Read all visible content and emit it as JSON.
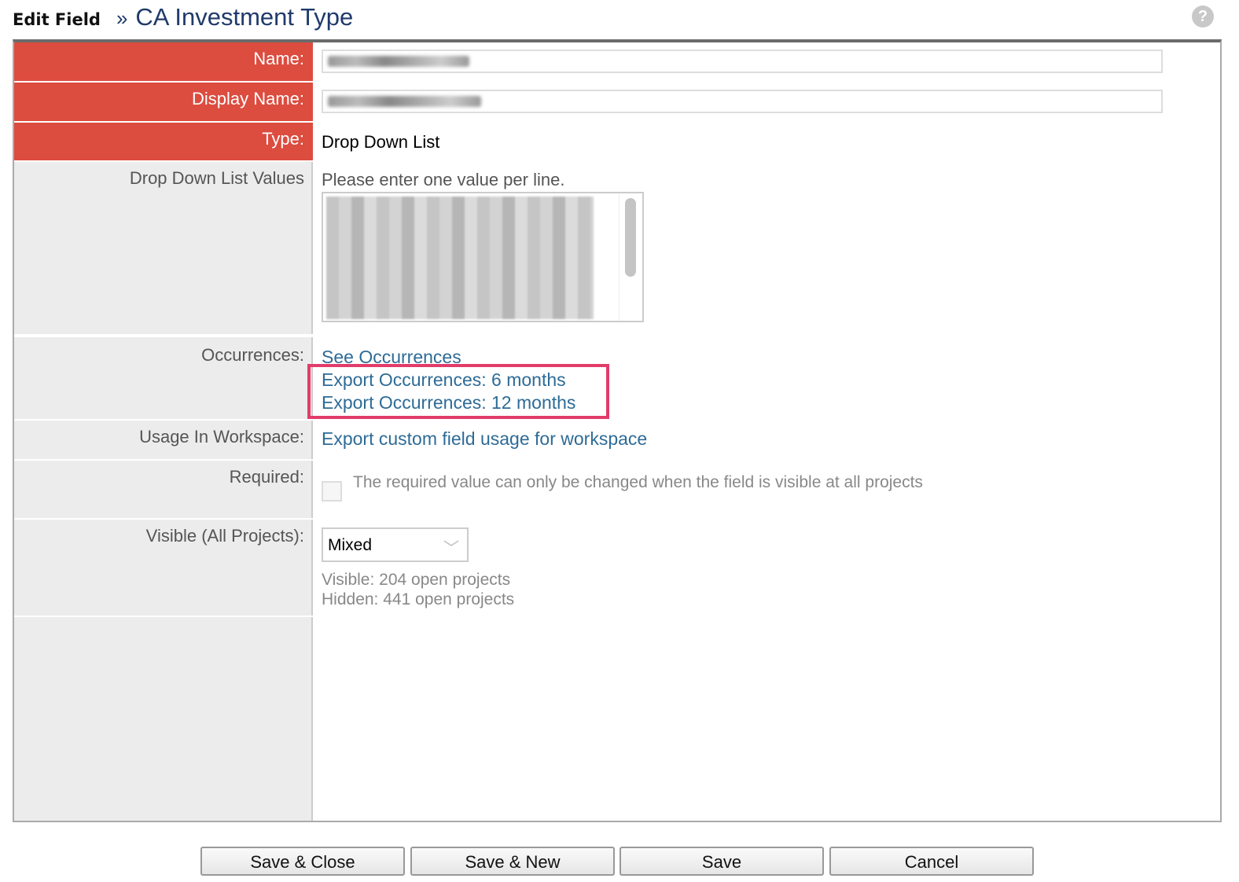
{
  "header": {
    "section": "Edit Field",
    "separator": "»",
    "title": "CA Investment Type",
    "help_icon": "?"
  },
  "fields": {
    "name": {
      "label": "Name:"
    },
    "display_name": {
      "label": "Display Name:"
    },
    "type": {
      "label": "Type:",
      "value": "Drop Down List"
    },
    "ddl_values": {
      "label": "Drop Down List Values",
      "hint": "Please enter one value per line."
    },
    "occurrences": {
      "label": "Occurrences:",
      "links": [
        "See Occurrences",
        "Export Occurrences: 6 months",
        "Export Occurrences: 12 months"
      ]
    },
    "usage": {
      "label": "Usage In Workspace:",
      "link": "Export custom field usage for workspace"
    },
    "required": {
      "label": "Required:",
      "note": "The required value can only be changed when the field is visible at all projects",
      "checked": false
    },
    "visible": {
      "label": "Visible (All Projects):",
      "selected": "Mixed",
      "visible_text": "Visible: 204 open projects",
      "hidden_text": "Hidden: 441 open projects"
    }
  },
  "buttons": [
    "Save & Close",
    "Save & New",
    "Save",
    "Cancel"
  ],
  "colors": {
    "required_label": "#dc4c3f",
    "link": "#2e6b96",
    "title": "#1f3a6b",
    "highlight": "#e23c6a"
  }
}
